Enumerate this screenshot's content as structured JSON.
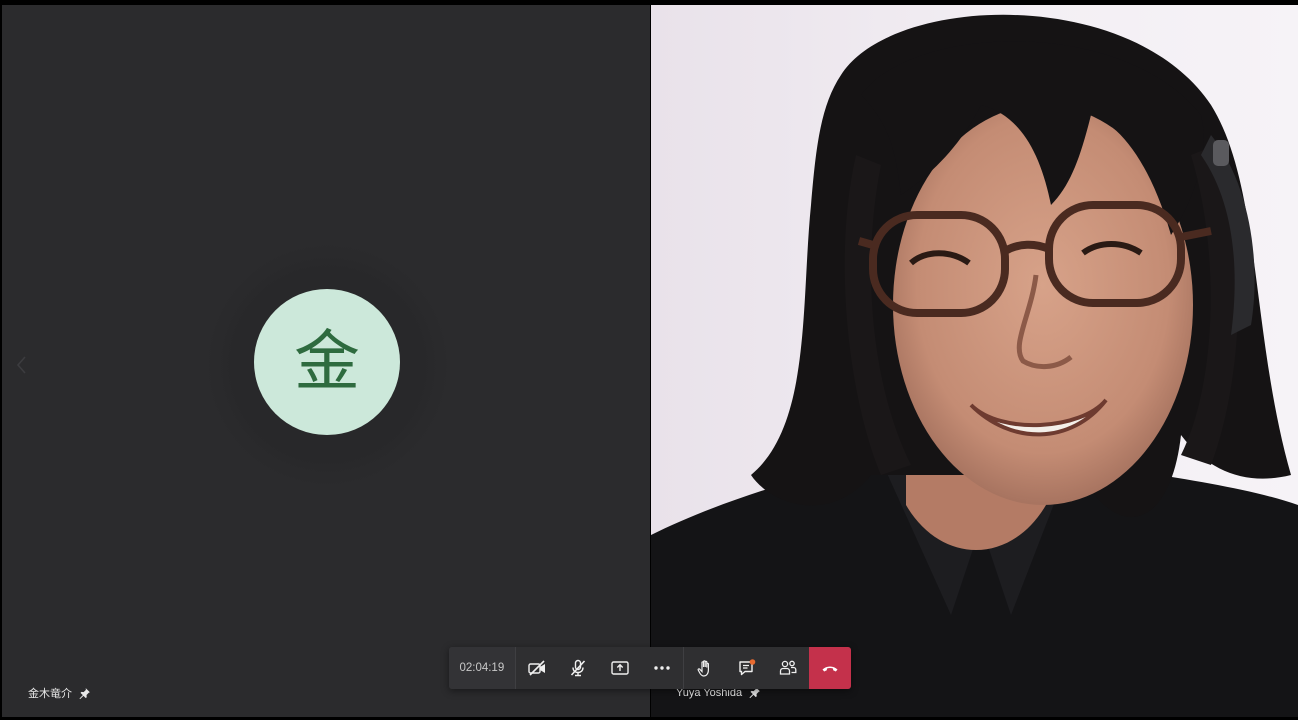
{
  "participants": {
    "left": {
      "avatar_initial": "金",
      "name": "金木竜介",
      "avatar_bg": "#cce8da",
      "avatar_fg": "#2e6b3f"
    },
    "right": {
      "name": "Yuya Yoshida"
    }
  },
  "call_controls": {
    "timer": "02:04:19",
    "buttons": [
      {
        "name": "camera-off-button",
        "icon": "video-off-icon"
      },
      {
        "name": "mute-button",
        "icon": "microphone-off-icon"
      },
      {
        "name": "share-screen-button",
        "icon": "share-screen-icon"
      },
      {
        "name": "more-actions-button",
        "icon": "more-horizontal-icon"
      },
      {
        "name": "raise-hand-button",
        "icon": "hand-icon"
      },
      {
        "name": "chat-button",
        "icon": "chat-icon"
      },
      {
        "name": "participants-button",
        "icon": "people-icon"
      },
      {
        "name": "hang-up-button",
        "icon": "phone-hangup-icon"
      }
    ],
    "hangup_color": "#c4314b",
    "notification_dot_color": "#e86a2f"
  }
}
